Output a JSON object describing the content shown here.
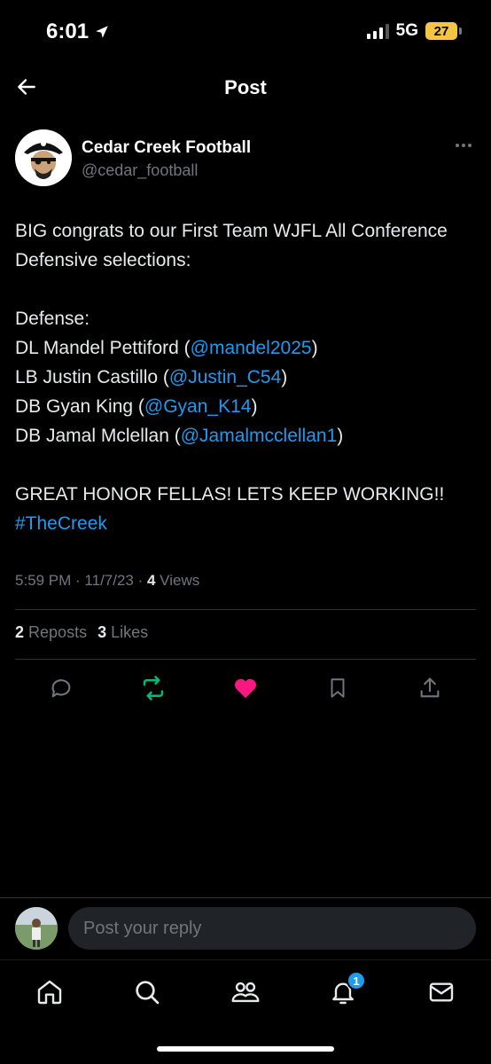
{
  "status": {
    "time": "6:01",
    "network": "5G",
    "battery": "27"
  },
  "header": {
    "title": "Post"
  },
  "author": {
    "display_name": "Cedar Creek Football",
    "handle": "@cedar_football"
  },
  "post": {
    "line1": "BIG congrats to our First Team WJFL All Conference Defensive selections:",
    "defense_label": "Defense:",
    "rows": [
      {
        "prefix": "DL Mandel Pettiford (",
        "mention": "@mandel2025",
        "suffix": ")"
      },
      {
        "prefix": "LB Justin Castillo (",
        "mention": "@Justin_C54",
        "suffix": ")"
      },
      {
        "prefix": "DB Gyan King (",
        "mention": "@Gyan_K14",
        "suffix": ")"
      },
      {
        "prefix": "DB Jamal Mclellan (",
        "mention": "@Jamalmcclellan1",
        "suffix": ")"
      }
    ],
    "closing": "GREAT HONOR FELLAS! LETS KEEP WORKING!!",
    "hashtag": "#TheCreek"
  },
  "meta": {
    "time_date": "5:59 PM · 11/7/23 · ",
    "views_count": "4",
    "views_label": " Views"
  },
  "stats": {
    "reposts_count": "2",
    "reposts_label": "Reposts",
    "likes_count": "3",
    "likes_label": "Likes"
  },
  "reply": {
    "placeholder": "Post your reply"
  },
  "nav": {
    "notifications_badge": "1"
  },
  "colors": {
    "accent": "#1d9bf0",
    "like": "#f91880",
    "repost": "#00ba7c",
    "battery": "#f4c542"
  }
}
